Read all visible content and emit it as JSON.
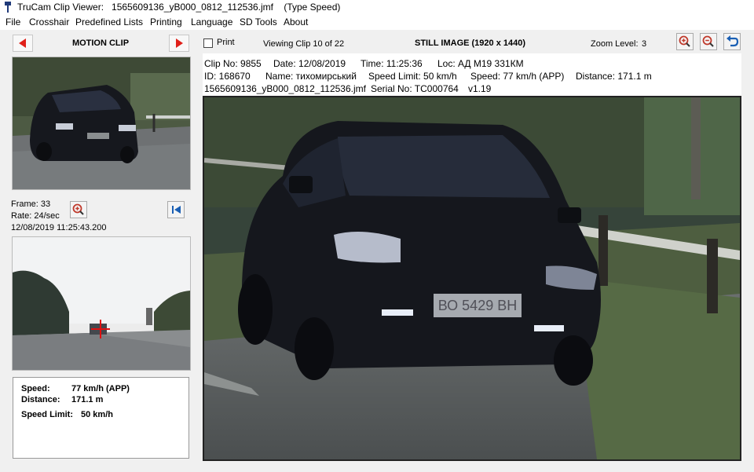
{
  "window": {
    "title": "TruCam Clip Viewer:   1565609136_yB000_0812_112536.jmf    (Type Speed)"
  },
  "menu": [
    "File",
    "Crosshair",
    "Predefined Lists",
    "Printing",
    "Language",
    "SD Tools",
    "About"
  ],
  "motion": {
    "title": "MOTION CLIP",
    "frame": "Frame: 33",
    "rate": "Rate: 24/sec",
    "timestamp": "12/08/2019 11:25:43.200"
  },
  "toolbar": {
    "print_label": "Print",
    "viewing": "Viewing Clip 10 of 22",
    "still_title": "STILL IMAGE (1920 x 1440)",
    "zoom_label": "Zoom Level:",
    "zoom_value": "3"
  },
  "info": {
    "line1": [
      "Clip No: 9855",
      "Date: 12/08/2019",
      "Time: 11:25:36",
      "Loc: АД М19 331КМ"
    ],
    "line2": [
      "ID: 168670",
      "Name: тихомирський",
      "Speed Limit: 50 km/h",
      "Speed: 77 km/h (APP)",
      "Distance: 171.1 m"
    ],
    "line3": [
      "1565609136_yB000_0812_112536.jmf",
      "Serial No: TC000764",
      "v1.19"
    ]
  },
  "summary": {
    "speed_label": "Speed:",
    "speed_value": "77 km/h (APP)",
    "distance_label": "Distance:",
    "distance_value": "171.1 m",
    "limit_label": "Speed Limit:",
    "limit_value": "50 km/h"
  },
  "plate_text": "ВО 5429 ВН",
  "colors": {
    "arrow": "#e0201a",
    "zoom_icon": "#c0392b",
    "blue_icon": "#1a5fb4",
    "crosshair": "#e01010"
  }
}
